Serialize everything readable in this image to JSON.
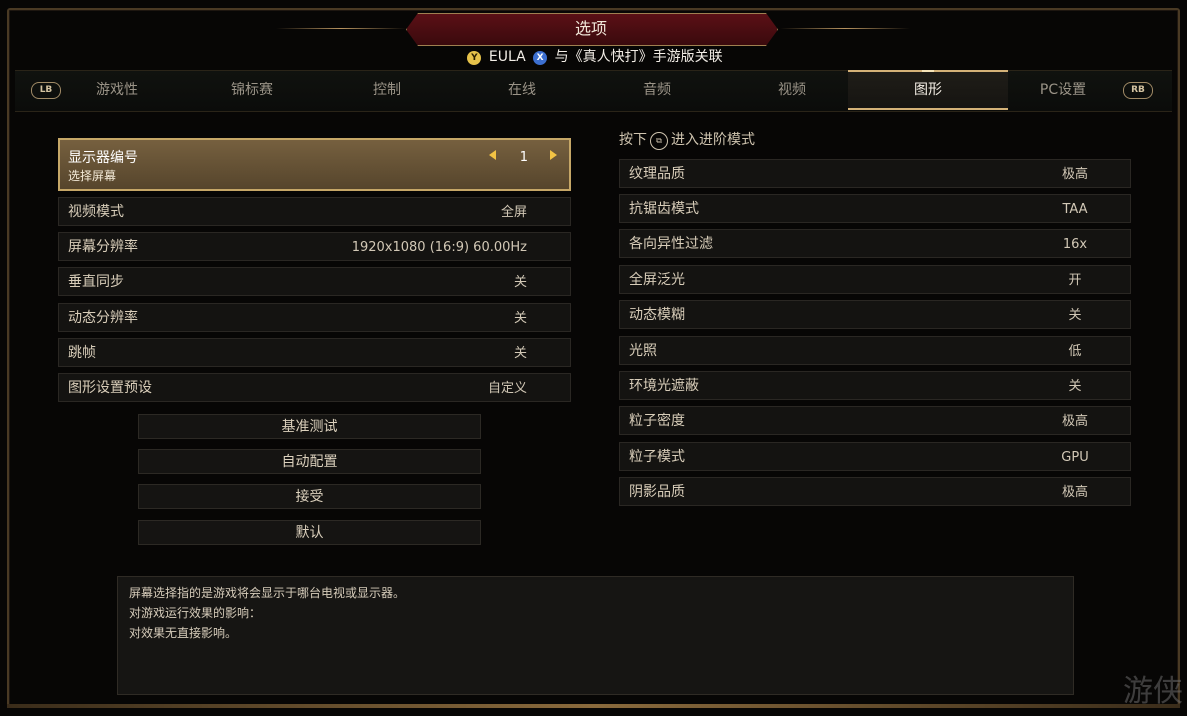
{
  "header": {
    "title": "选项",
    "y_button": "Y",
    "eula": "EULA",
    "x_button": "X",
    "link_text": "与《真人快打》手游版关联"
  },
  "tabs": {
    "lb": "LB",
    "rb": "RB",
    "items": [
      "游戏性",
      "锦标赛",
      "控制",
      "在线",
      "音频",
      "视频",
      "图形",
      "PC设置"
    ],
    "active": "图形"
  },
  "left": {
    "monitor": {
      "label": "显示器编号",
      "sublabel": "选择屏幕",
      "value": "1"
    },
    "rows": [
      {
        "label": "视频模式",
        "value": "全屏"
      },
      {
        "label": "屏幕分辨率",
        "value": "1920x1080 (16:9) 60.00Hz"
      },
      {
        "label": "垂直同步",
        "value": "关"
      },
      {
        "label": "动态分辨率",
        "value": "关"
      },
      {
        "label": "跳帧",
        "value": "关"
      },
      {
        "label": "图形设置预设",
        "value": "自定义"
      }
    ],
    "actions": [
      "基准测试",
      "自动配置",
      "接受",
      "默认"
    ]
  },
  "right": {
    "hint_prefix": "按下",
    "hint_suffix": "进入进阶模式",
    "rows": [
      {
        "label": "纹理品质",
        "value": "极高"
      },
      {
        "label": "抗锯齿模式",
        "value": "TAA"
      },
      {
        "label": "各向异性过滤",
        "value": "16x"
      },
      {
        "label": "全屏泛光",
        "value": "开"
      },
      {
        "label": "动态模糊",
        "value": "关"
      },
      {
        "label": "光照",
        "value": "低"
      },
      {
        "label": "环境光遮蔽",
        "value": "关"
      },
      {
        "label": "粒子密度",
        "value": "极高"
      },
      {
        "label": "粒子模式",
        "value": "GPU"
      },
      {
        "label": "阴影品质",
        "value": "极高"
      }
    ]
  },
  "description": {
    "lines": [
      "屏幕选择指的是游戏将会显示于哪台电视或显示器。",
      "对游戏运行效果的影响：",
      "对效果无直接影响。"
    ]
  },
  "watermark": "游侠",
  "colors": {
    "accent_gold": "#c6a767",
    "title_red": "#5b1016",
    "arrow_yellow": "#f2c344"
  }
}
